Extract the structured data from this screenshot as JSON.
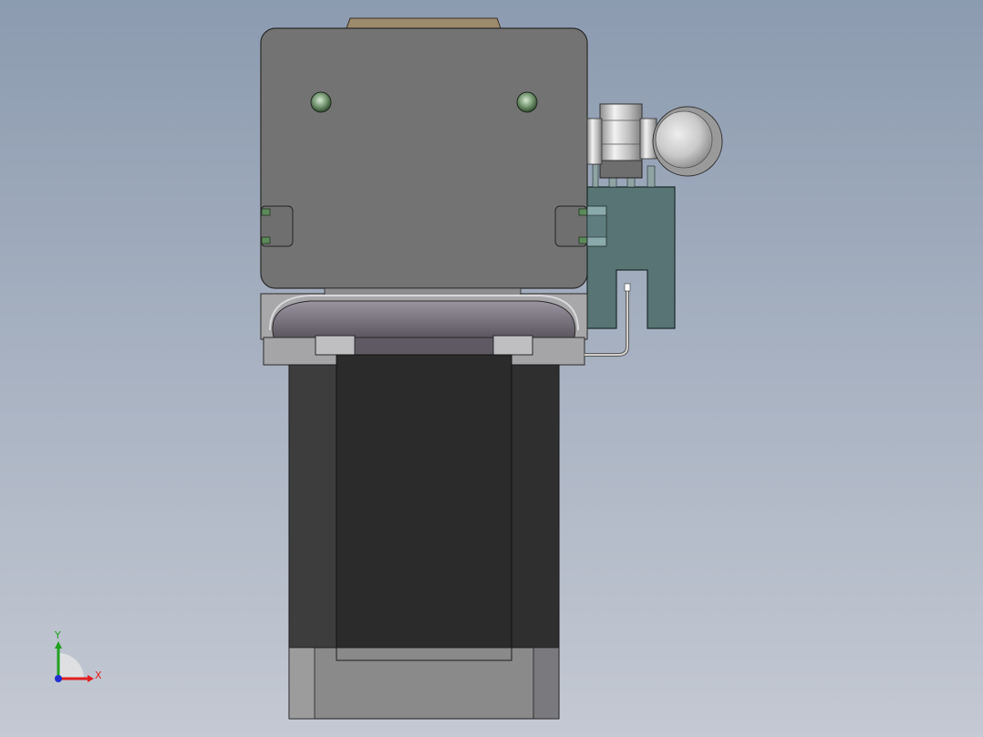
{
  "view": {
    "name": "cad-model-front-view",
    "background_top": "#8d9cb0",
    "background_bottom": "#c3c8d2"
  },
  "model": {
    "housing_color": "#727272",
    "housing_edge": "#2a2a2a",
    "motor_body_color": "#2b2b2b",
    "motor_side_color": "#3a3a3a",
    "motor_end_cap_color": "#868686",
    "bracket_color": "#587373",
    "plate_color": "#a9a9a9",
    "belt_color": "#9b8a6d",
    "screw_color": "#6b8f68",
    "fitting_color": "#d9d9d9"
  },
  "triad": {
    "x_label": "X",
    "y_label": "Y",
    "x_color": "#e02020",
    "y_color": "#20a020",
    "z_color": "#2030d0"
  }
}
